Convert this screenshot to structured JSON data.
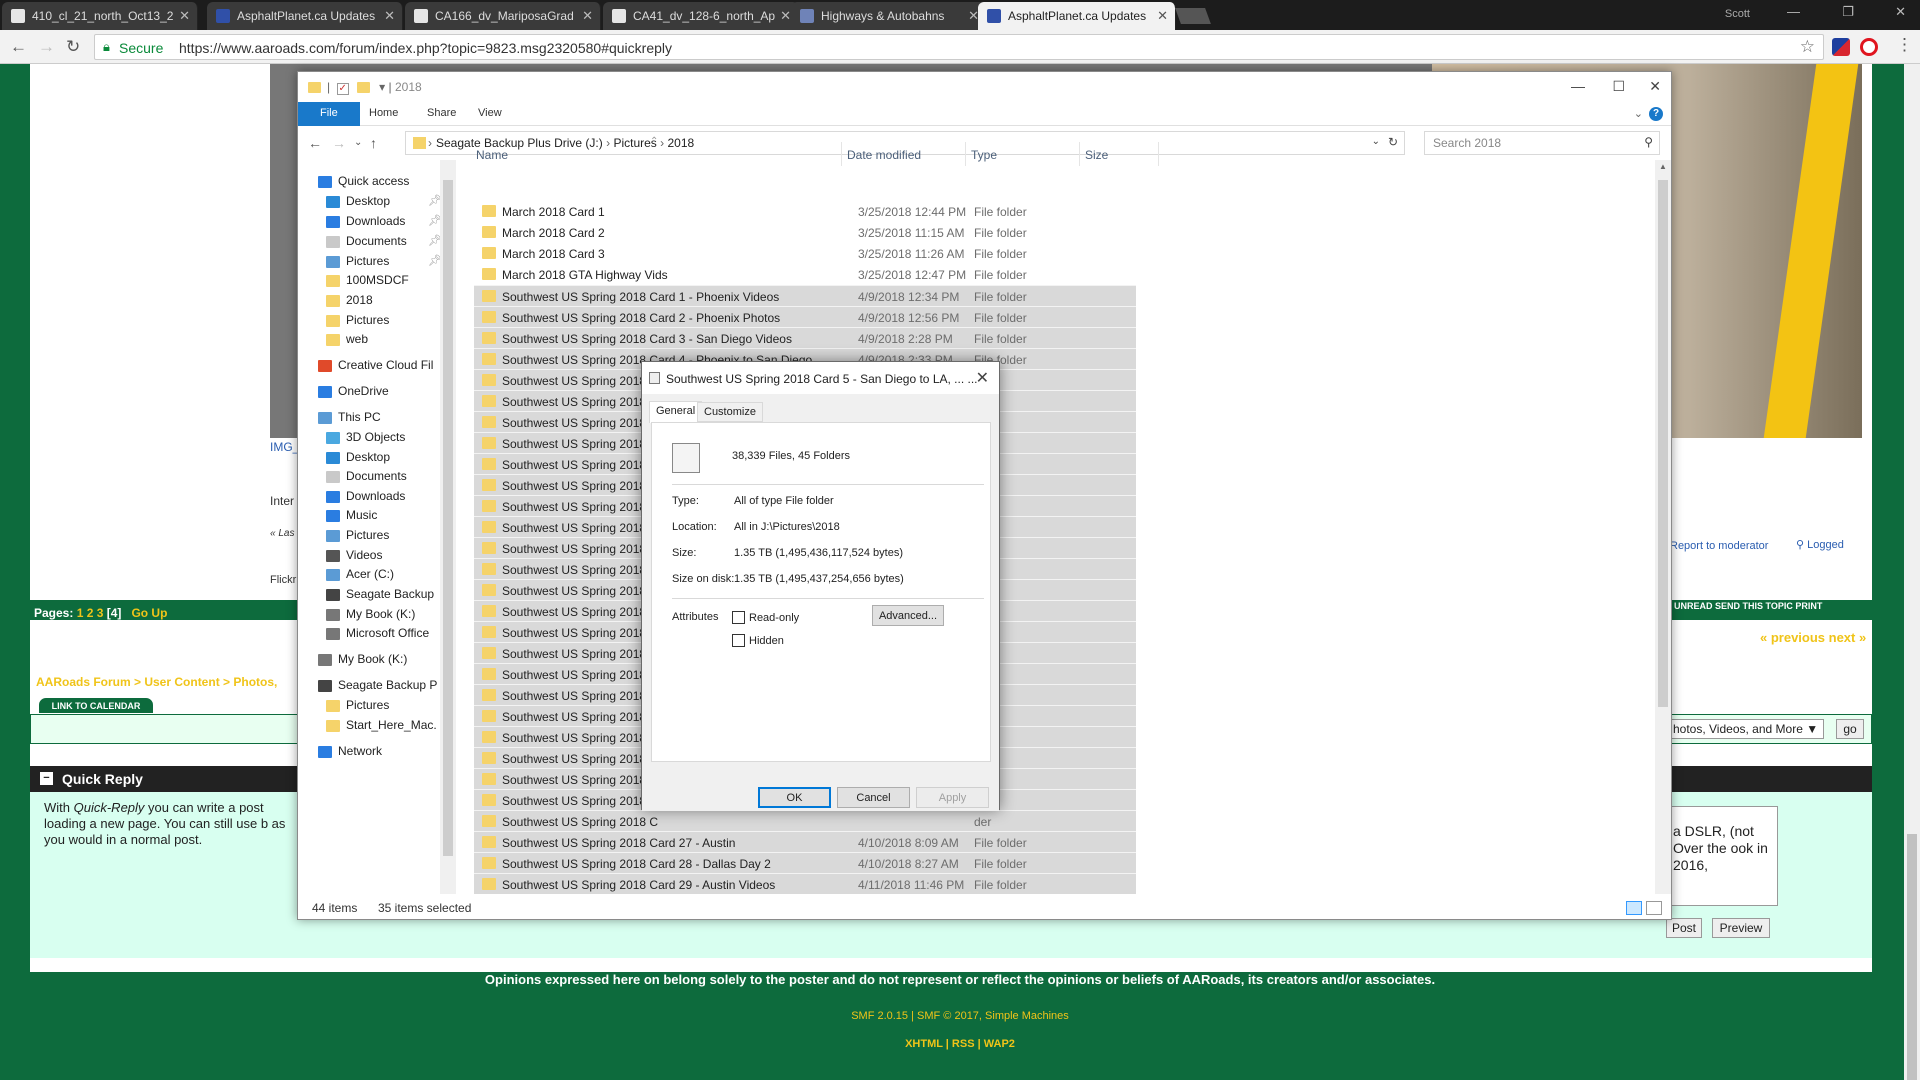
{
  "browser": {
    "tabs": [
      {
        "label": "410_cl_21_north_Oct13_2",
        "fav": "#e6e6e6",
        "active": false
      },
      {
        "label": "AsphaltPlanet.ca Updates",
        "fav": "#3050a8",
        "active": false
      },
      {
        "label": "CA166_dv_MariposaGrad",
        "fav": "#e6e6e6",
        "active": false
      },
      {
        "label": "CA41_dv_128-6_north_Ap",
        "fav": "#e6e6e6",
        "active": false
      },
      {
        "label": "Highways & Autobahns",
        "fav": "#6f83b8",
        "active": false
      },
      {
        "label": "AsphaltPlanet.ca Updates",
        "fav": "#3050a8",
        "active": true
      }
    ],
    "user": "Scott",
    "secure_label": "Secure",
    "url": "https://www.aaroads.com/forum/index.php?topic=9823.msg2320580#quickreply"
  },
  "forum": {
    "img_caption": "IMG_",
    "inter_text": "Inter",
    "last_text": "« Las",
    "flickr_text": "Flickr",
    "pages_label": "Pages:",
    "pages_links": "1 2 3",
    "current_page": "[4]",
    "go_up": "Go Up",
    "report": "Report to moderator",
    "logged": "Logged",
    "right_links": "UNREAD   SEND THIS TOPIC   PRINT",
    "prev_next": "« previous next »",
    "breadcrumb": "AARoads Forum >  User Content >  Photos,",
    "calendar_btn": "LINK TO CALENDAR",
    "jump_select": "hotos, Videos, and More ▼",
    "go_btn": "go",
    "quick_reply_title": "Quick Reply",
    "quick_reply_text_a": "With ",
    "quick_reply_text_em": "Quick-Reply",
    "quick_reply_text_b": " you can write a post loading a new page. You can still use b as you would in a normal post.",
    "textarea_text": "a DSLR, (not Over the ook in 2016,",
    "post_btn": "Post",
    "preview_btn": "Preview",
    "footer_disclaimer": "Opinions expressed here on belong solely to the poster and do not represent or reflect the opinions or beliefs of AARoads, its creators and/or associates.",
    "footer_smf": "SMF 2.0.15 | SMF © 2017, Simple Machines",
    "footer_links": "XHTML | RSS | WAP2"
  },
  "explorer": {
    "title": "2018",
    "ribbon_tabs": [
      "File",
      "Home",
      "Share",
      "View"
    ],
    "path": [
      "Seagate Backup Plus Drive (J:)",
      "Pictures",
      "2018"
    ],
    "search_placeholder": "Search 2018",
    "columns": {
      "name": "Name",
      "date": "Date modified",
      "type": "Type",
      "size": "Size"
    },
    "nav": [
      {
        "label": "Quick access",
        "icon": "star-icon",
        "color": "#2a7de1",
        "indent": 0,
        "pin": false
      },
      {
        "label": "Desktop",
        "icon": "desktop-icon",
        "color": "#2a8ad6",
        "indent": 1,
        "pin": true
      },
      {
        "label": "Downloads",
        "icon": "download-icon",
        "color": "#2a7de1",
        "indent": 1,
        "pin": true
      },
      {
        "label": "Documents",
        "icon": "document-icon",
        "color": "#c9c9c9",
        "indent": 1,
        "pin": true
      },
      {
        "label": "Pictures",
        "icon": "pictures-icon",
        "color": "#5b9bd5",
        "indent": 1,
        "pin": true
      },
      {
        "label": "100MSDCF",
        "icon": "folder-icon",
        "color": "#f5d36a",
        "indent": 1,
        "pin": false
      },
      {
        "label": "2018",
        "icon": "folder-icon",
        "color": "#f5d36a",
        "indent": 1,
        "pin": false
      },
      {
        "label": "Pictures",
        "icon": "folder-icon",
        "color": "#f5d36a",
        "indent": 1,
        "pin": false
      },
      {
        "label": "web",
        "icon": "folder-icon",
        "color": "#f5d36a",
        "indent": 1,
        "pin": false
      },
      {
        "label": "Creative Cloud Fil",
        "icon": "creative-cloud-icon",
        "color": "#e04a2a",
        "indent": 0,
        "pin": false
      },
      {
        "label": "OneDrive",
        "icon": "onedrive-icon",
        "color": "#2a7de1",
        "indent": 0,
        "pin": false
      },
      {
        "label": "This PC",
        "icon": "computer-icon",
        "color": "#5b9bd5",
        "indent": 0,
        "pin": false
      },
      {
        "label": "3D Objects",
        "icon": "3d-objects-icon",
        "color": "#4aa8e0",
        "indent": 1,
        "pin": false
      },
      {
        "label": "Desktop",
        "icon": "desktop-icon",
        "color": "#2a8ad6",
        "indent": 1,
        "pin": false
      },
      {
        "label": "Documents",
        "icon": "document-icon",
        "color": "#c9c9c9",
        "indent": 1,
        "pin": false
      },
      {
        "label": "Downloads",
        "icon": "download-icon",
        "color": "#2a7de1",
        "indent": 1,
        "pin": false
      },
      {
        "label": "Music",
        "icon": "music-icon",
        "color": "#2a7de1",
        "indent": 1,
        "pin": false
      },
      {
        "label": "Pictures",
        "icon": "pictures-icon",
        "color": "#5b9bd5",
        "indent": 1,
        "pin": false
      },
      {
        "label": "Videos",
        "icon": "videos-icon",
        "color": "#555555",
        "indent": 1,
        "pin": false
      },
      {
        "label": "Acer (C:)",
        "icon": "drive-icon",
        "color": "#5b9bd5",
        "indent": 1,
        "pin": false
      },
      {
        "label": "Seagate Backup",
        "icon": "drive-icon",
        "color": "#444444",
        "indent": 1,
        "pin": false
      },
      {
        "label": "My Book (K:)",
        "icon": "drive-icon",
        "color": "#777777",
        "indent": 1,
        "pin": false
      },
      {
        "label": "Microsoft Office",
        "icon": "drive-icon",
        "color": "#777777",
        "indent": 1,
        "pin": false
      },
      {
        "label": "My Book (K:)",
        "icon": "drive-icon",
        "color": "#777777",
        "indent": 0,
        "pin": false
      },
      {
        "label": "Seagate Backup P",
        "icon": "drive-icon",
        "color": "#444444",
        "indent": 0,
        "pin": false
      },
      {
        "label": "Pictures",
        "icon": "folder-icon",
        "color": "#f5d36a",
        "indent": 1,
        "pin": false
      },
      {
        "label": "Start_Here_Mac.",
        "icon": "folder-icon",
        "color": "#f5d36a",
        "indent": 1,
        "pin": false
      },
      {
        "label": "Network",
        "icon": "network-icon",
        "color": "#2a7de1",
        "indent": 0,
        "pin": false
      }
    ],
    "files": [
      {
        "name": "March 2018 Card 1",
        "date": "3/25/2018 12:44 PM",
        "type": "File folder",
        "sel": false
      },
      {
        "name": "March 2018 Card 2",
        "date": "3/25/2018 11:15 AM",
        "type": "File folder",
        "sel": false
      },
      {
        "name": "March 2018 Card 3",
        "date": "3/25/2018 11:26 AM",
        "type": "File folder",
        "sel": false
      },
      {
        "name": "March 2018 GTA Highway Vids",
        "date": "3/25/2018 12:47 PM",
        "type": "File folder",
        "sel": false
      },
      {
        "name": "Southwest US Spring 2018 Card 1 - Phoenix Videos",
        "date": "4/9/2018 12:34 PM",
        "type": "File folder",
        "sel": true
      },
      {
        "name": "Southwest US Spring 2018 Card 2 - Phoenix Photos",
        "date": "4/9/2018 12:56 PM",
        "type": "File folder",
        "sel": true
      },
      {
        "name": "Southwest US Spring 2018 Card 3 - San Diego Videos",
        "date": "4/9/2018 2:28 PM",
        "type": "File folder",
        "sel": true
      },
      {
        "name": "Southwest US Spring 2018 Card 4 - Phoenix to San Diego",
        "date": "4/9/2018 2:33 PM",
        "type": "File folder",
        "sel": true
      },
      {
        "name": "Southwest US Spring 2018 C",
        "date": "",
        "type": "der",
        "sel": true
      },
      {
        "name": "Southwest US Spring 2018 C",
        "date": "",
        "type": "der",
        "sel": true
      },
      {
        "name": "Southwest US Spring 2018 C",
        "date": "",
        "type": "der",
        "sel": true
      },
      {
        "name": "Southwest US Spring 2018 C",
        "date": "",
        "type": "der",
        "sel": true
      },
      {
        "name": "Southwest US Spring 2018 C",
        "date": "",
        "type": "der",
        "sel": true
      },
      {
        "name": "Southwest US Spring 2018 C",
        "date": "",
        "type": "der",
        "sel": true
      },
      {
        "name": "Southwest US Spring 2018 C",
        "date": "",
        "type": "der",
        "sel": true
      },
      {
        "name": "Southwest US Spring 2018 C",
        "date": "",
        "type": "der",
        "sel": true
      },
      {
        "name": "Southwest US Spring 2018 C",
        "date": "",
        "type": "der",
        "sel": true
      },
      {
        "name": "Southwest US Spring 2018 C",
        "date": "",
        "type": "der",
        "sel": true
      },
      {
        "name": "Southwest US Spring 2018 C",
        "date": "",
        "type": "der",
        "sel": true
      },
      {
        "name": "Southwest US Spring 2018 C",
        "date": "",
        "type": "der",
        "sel": true
      },
      {
        "name": "Southwest US Spring 2018 C",
        "date": "",
        "type": "der",
        "sel": true
      },
      {
        "name": "Southwest US Spring 2018 C",
        "date": "",
        "type": "der",
        "sel": true
      },
      {
        "name": "Southwest US Spring 2018 C",
        "date": "",
        "type": "der",
        "sel": true
      },
      {
        "name": "Southwest US Spring 2018 C",
        "date": "",
        "type": "der",
        "sel": true
      },
      {
        "name": "Southwest US Spring 2018 C",
        "date": "",
        "type": "der",
        "sel": true
      },
      {
        "name": "Southwest US Spring 2018 C",
        "date": "",
        "type": "der",
        "sel": true
      },
      {
        "name": "Southwest US Spring 2018 C",
        "date": "",
        "type": "der",
        "sel": true
      },
      {
        "name": "Southwest US Spring 2018 C",
        "date": "",
        "type": "der",
        "sel": true
      },
      {
        "name": "Southwest US Spring 2018 C",
        "date": "",
        "type": "der",
        "sel": true
      },
      {
        "name": "Southwest US Spring 2018 C",
        "date": "",
        "type": "der",
        "sel": true
      },
      {
        "name": "Southwest US Spring 2018 Card 27 - Austin",
        "date": "4/10/2018 8:09 AM",
        "type": "File folder",
        "sel": true
      },
      {
        "name": "Southwest US Spring 2018 Card 28 - Dallas Day 2",
        "date": "4/10/2018 8:27 AM",
        "type": "File folder",
        "sel": true
      },
      {
        "name": "Southwest US Spring 2018 Card 29 - Austin Videos",
        "date": "4/11/2018 11:46 PM",
        "type": "File folder",
        "sel": true
      }
    ],
    "status_items": "44 items",
    "status_selected": "35 items selected"
  },
  "dialog": {
    "title": "Southwest US Spring 2018 Card 5 - San Diego to LA, ... ...",
    "tabs": [
      "General",
      "Customize"
    ],
    "summary": "38,339 Files, 45 Folders",
    "type_label": "Type:",
    "type_value": "All of type File folder",
    "location_label": "Location:",
    "location_value": "All in J:\\Pictures\\2018",
    "size_label": "Size:",
    "size_value": "1.35 TB (1,495,436,117,524 bytes)",
    "disk_label": "Size on disk:",
    "disk_value": "1.35 TB (1,495,437,254,656 bytes)",
    "attributes_label": "Attributes",
    "readonly_label": "Read-only",
    "hidden_label": "Hidden",
    "advanced_btn": "Advanced...",
    "ok_btn": "OK",
    "cancel_btn": "Cancel",
    "apply_btn": "Apply"
  }
}
